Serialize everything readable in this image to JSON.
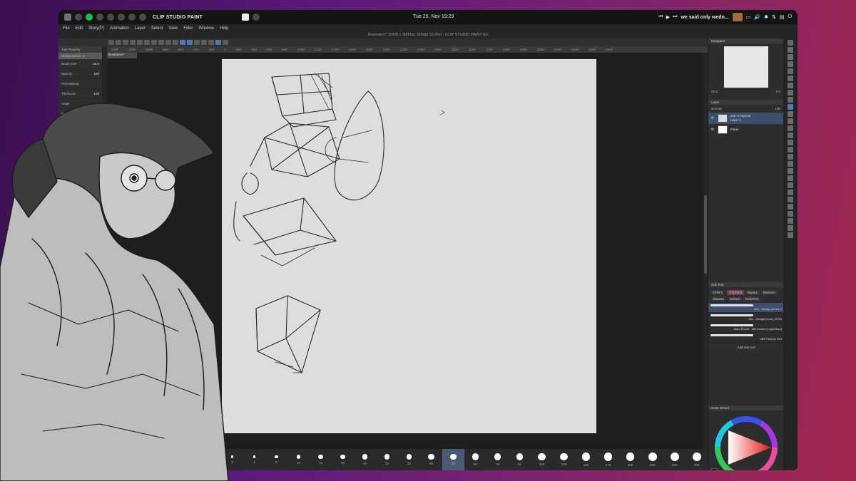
{
  "os_bar": {
    "app_name": "CLIP STUDIO PAINT",
    "clock": "Tue 25, Nov 19:29",
    "track": "we said only wedn..."
  },
  "window": {
    "title": "Illustration* (5000 x 5000px 350dpi 23.6%) - CLIP STUDIO PAINT EX",
    "menu": [
      "File",
      "Edit",
      "Story(P)",
      "Animation",
      "Layer",
      "Select",
      "View",
      "Filter",
      "Window",
      "Help"
    ]
  },
  "left_panel": {
    "header": "Tool Property",
    "subheader": "Design pencil_2",
    "rows": [
      {
        "label": "Brush Size",
        "value": "50.0"
      },
      {
        "label": "Opacity",
        "value": "100"
      },
      {
        "label": "Anti-aliasing",
        "value": ""
      },
      {
        "label": "Thickness",
        "value": "100"
      },
      {
        "label": "Angle",
        "value": ""
      },
      {
        "label": "Brush density",
        "value": ""
      },
      {
        "label": "Texture",
        "value": ""
      }
    ]
  },
  "canvas": {
    "doc_tab": "Illustration*",
    "ruler_ticks": [
      "1400",
      "1200",
      "1000",
      "800",
      "600",
      "400",
      "200",
      "0",
      "200",
      "400",
      "600",
      "800",
      "1000",
      "1200",
      "1400",
      "1600",
      "1800",
      "2000",
      "2200",
      "2400",
      "2600",
      "2800",
      "3000",
      "3200",
      "3400",
      "3600",
      "3800",
      "4000",
      "4200",
      "4400",
      "4600"
    ]
  },
  "brush_sizes": {
    "items": [
      "3",
      "4",
      "5",
      "10",
      "12",
      "15",
      "20",
      "25",
      "30",
      "40",
      "50",
      "60",
      "70",
      "80",
      "100",
      "120",
      "150",
      "170",
      "200",
      "250",
      "300",
      "400"
    ],
    "selected": "50"
  },
  "right_panel": {
    "navigator": {
      "title": "Navigator",
      "zoom": "25.3",
      "angle": "0.0"
    },
    "layer": {
      "title": "Layer",
      "blend_mode": "Normal",
      "opacity": "100",
      "layers": [
        {
          "name": "100 % Normal",
          "sub": "Layer 1",
          "selected": true
        },
        {
          "name": "",
          "sub": "Paper",
          "selected": false
        }
      ]
    },
    "subtool": {
      "title": "Sub Tool",
      "tabs": [
        "ZERFC",
        "XTEPEN",
        "Bigaka",
        "Raetarte",
        "dlasarte",
        "MONO",
        "NekoPen"
      ],
      "selected_tab": "XTEPEN",
      "items": [
        {
          "label": "IKU - Design pencil_2",
          "selected": true
        },
        {
          "label": "IKU - Design pencil_2CPA",
          "selected": false
        },
        {
          "label": "Marc Brunet - MB Lineart (Legendary)",
          "selected": false
        },
        {
          "label": "SBP Pseudo Pen",
          "selected": false
        }
      ],
      "add_label": "Add sub tool"
    },
    "color": {
      "title": "Color Wheel"
    }
  },
  "size_readout": "50.0",
  "opacity_readout": "100"
}
